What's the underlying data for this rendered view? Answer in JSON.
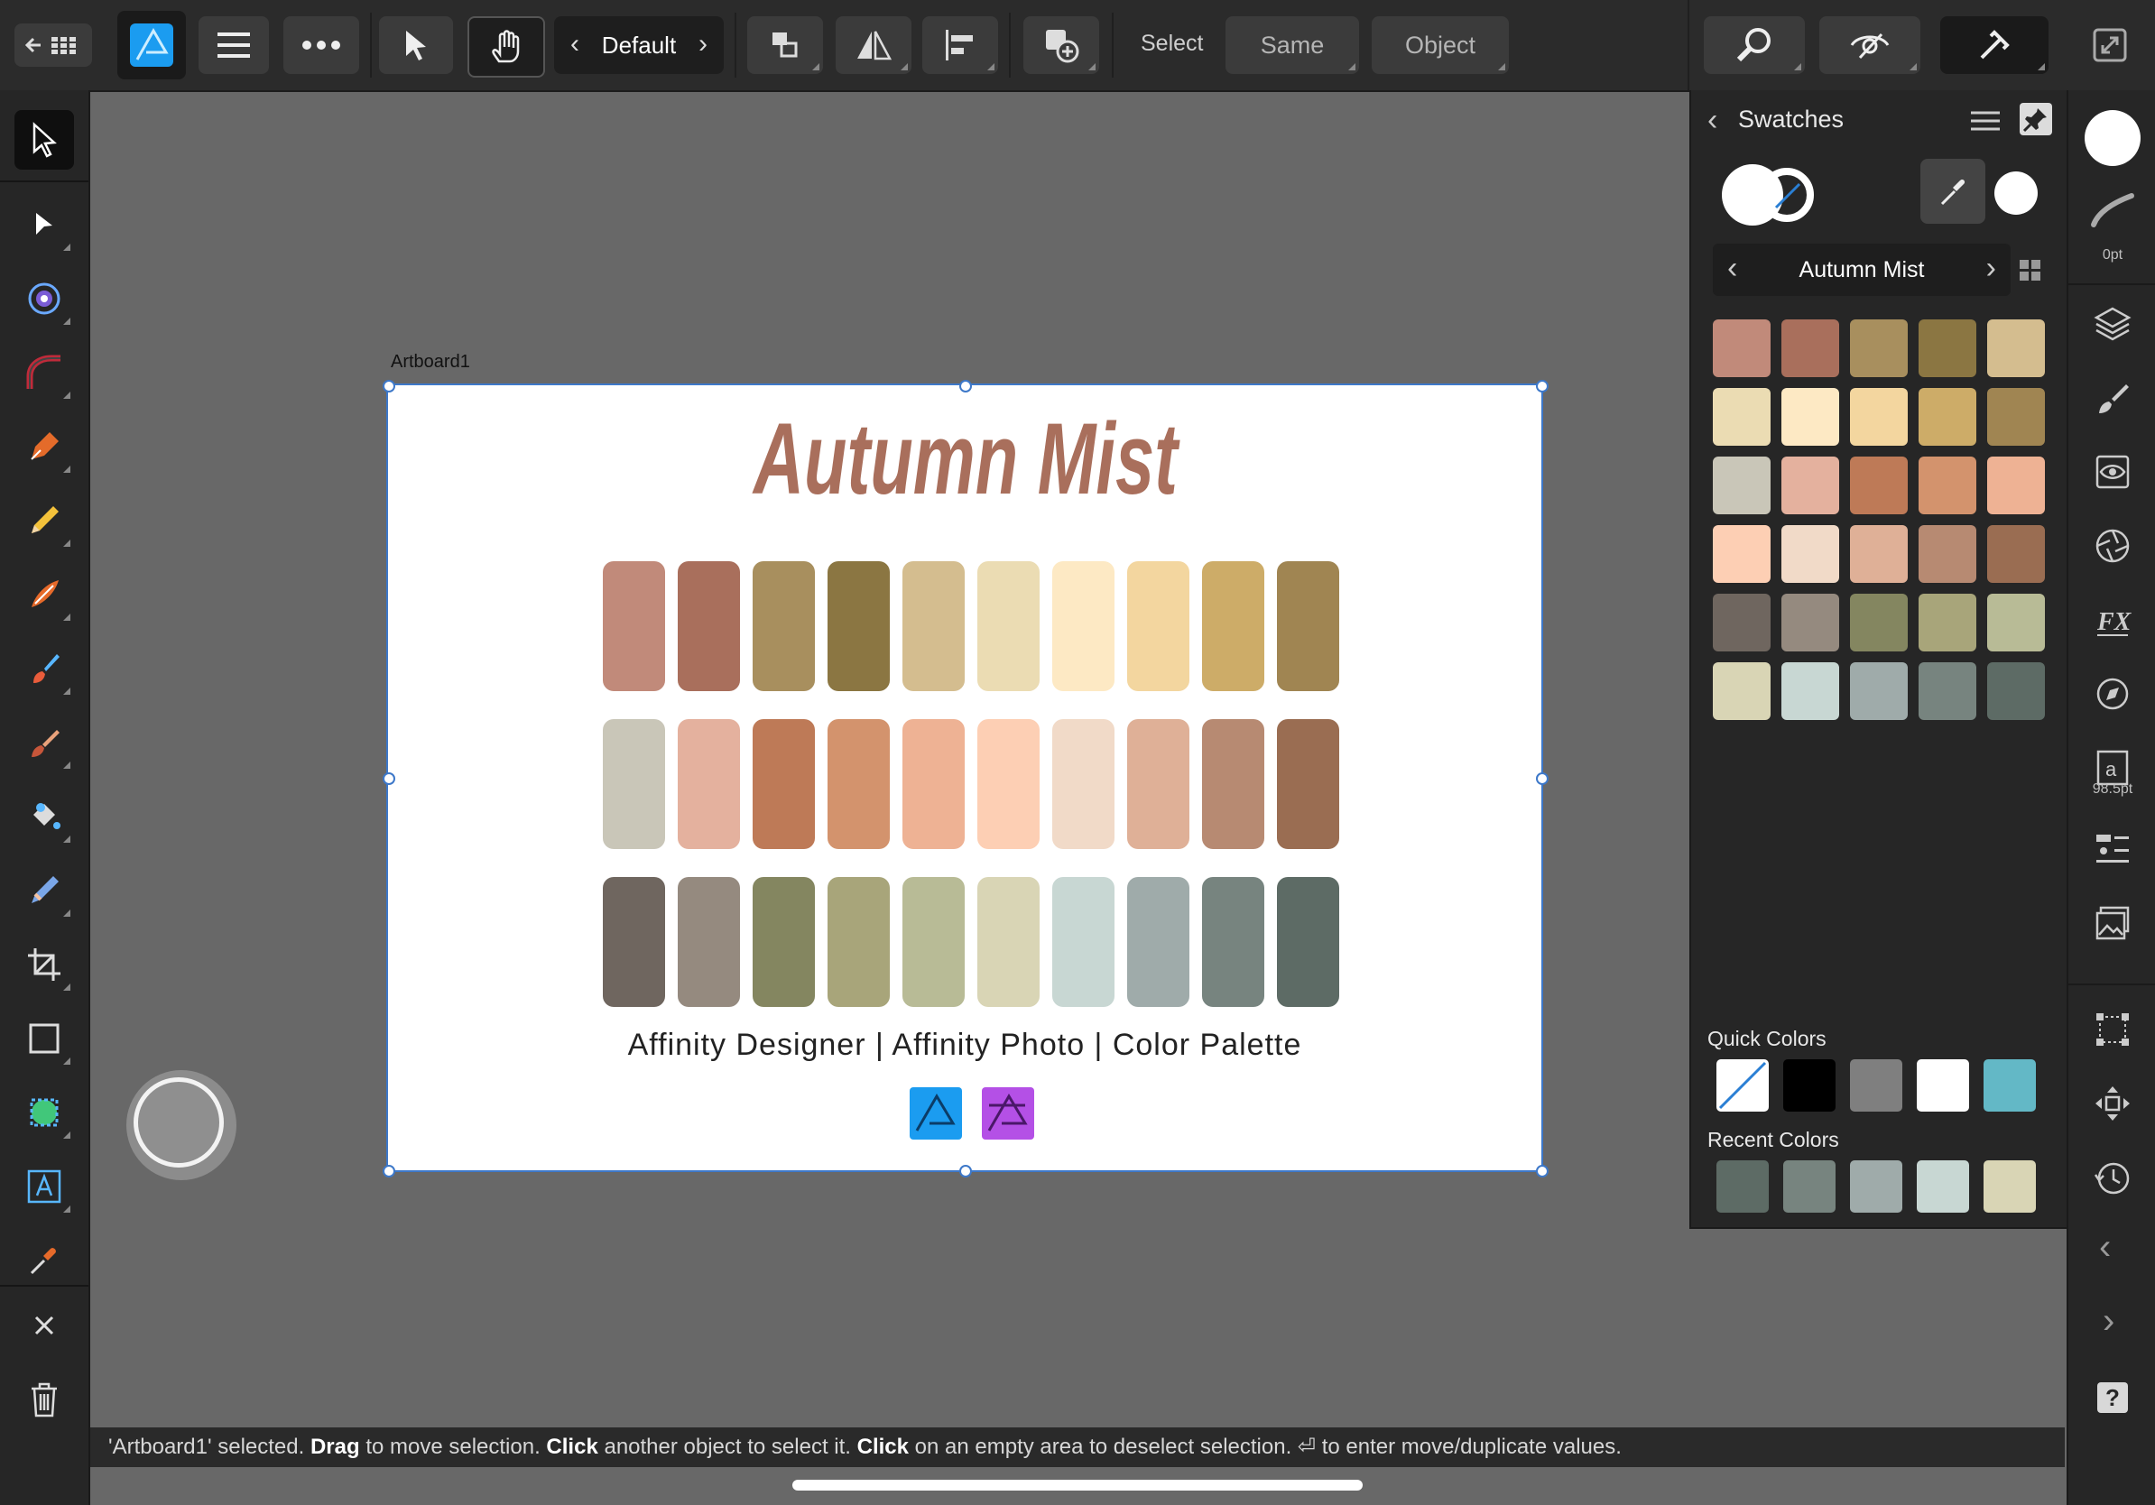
{
  "toolbar": {
    "persona_label": "Default",
    "select_label": "Select",
    "same_label": "Same",
    "object_label": "Object"
  },
  "panel": {
    "title": "Swatches",
    "palette_name": "Autumn Mist",
    "quick_colors_label": "Quick Colors",
    "recent_colors_label": "Recent Colors",
    "swatches": [
      "#c18a7a",
      "#a96f5c",
      "#a88f5e",
      "#8b7642",
      "#d4bd8f",
      "#ebdcb3",
      "#fde9c4",
      "#f3d69f",
      "#cdac68",
      "#a08552",
      "#c9c6b8",
      "#e4b19e",
      "#be7a57",
      "#d3936d",
      "#eeb294",
      "#fdcfb4",
      "#f1dac8",
      "#dfb097",
      "#b78a72",
      "#9a6d52",
      "#6f665f",
      "#958a7f",
      "#848660",
      "#a8a57a",
      "#b8bb96",
      "#d9d5b5",
      "#c8d7d3",
      "#9fabaa",
      "#77847f",
      "#5d6b65"
    ],
    "quick_colors": [
      "none",
      "#000000",
      "#7f7f7f",
      "#ffffff",
      "#63b8c6"
    ],
    "recent_colors": [
      "#5d6b65",
      "#77847f",
      "#9fabaa",
      "#c8d7d3",
      "#d9d5b5"
    ]
  },
  "studio": {
    "stroke_width_label": "0pt",
    "font_size_label": "98.5pt"
  },
  "canvas": {
    "artboard_name": "Artboard1",
    "art_title": "Autumn Mist",
    "subtitle": "Affinity Designer | Affinity Photo | Color Palette",
    "palette_rows": [
      [
        "#c18a7a",
        "#a96f5c",
        "#a88f5e",
        "#8b7642",
        "#d4bd8f",
        "#ebdcb3",
        "#fde9c4",
        "#f3d69f",
        "#cdac68",
        "#a08552"
      ],
      [
        "#c9c6b8",
        "#e4b19e",
        "#be7a57",
        "#d3936d",
        "#eeb294",
        "#fdcfb4",
        "#f1dac8",
        "#dfb097",
        "#b78a72",
        "#9a6d52"
      ],
      [
        "#6f665f",
        "#958a7f",
        "#848660",
        "#a8a57a",
        "#b8bb96",
        "#d9d5b5",
        "#c8d7d3",
        "#9fabaa",
        "#77847f",
        "#5d6b65"
      ]
    ]
  },
  "status": {
    "p1": "'Artboard1' selected. ",
    "b1": "Drag",
    "p2": " to move selection. ",
    "b2": "Click",
    "p3": " another object to select it. ",
    "b3": "Click",
    "p4": " on an empty area to deselect selection. ⏎ to enter move/duplicate values."
  },
  "colors": {
    "accent": "#3d78c9",
    "title_color": "#a96f5c"
  }
}
